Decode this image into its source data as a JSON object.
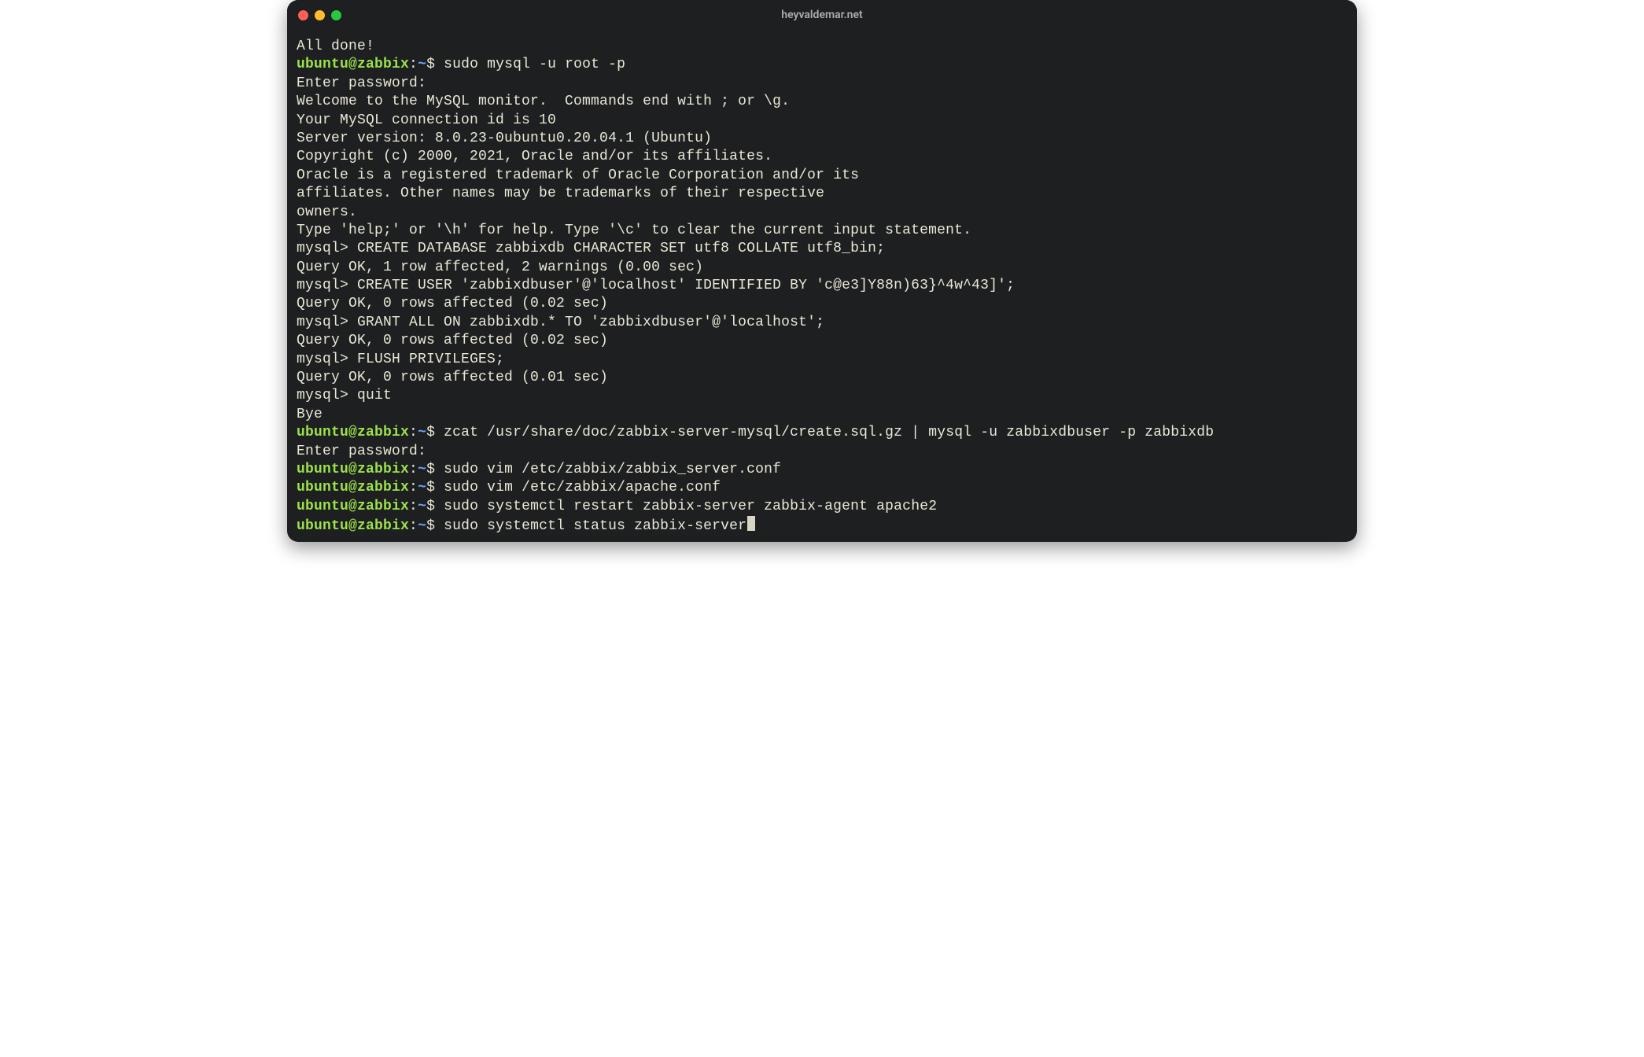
{
  "window": {
    "title": "heyvaldemar.net",
    "traffic_lights": [
      "close",
      "minimize",
      "zoom"
    ]
  },
  "prompt": {
    "user": "ubuntu",
    "at": "@",
    "host": "zabbix",
    "colon": ":",
    "path": "~",
    "dollar": "$ "
  },
  "colors": {
    "bg": "#1e1f21",
    "fg": "#e9e8d6",
    "user": "#9be24a",
    "path": "#6aa6ff"
  },
  "lines": {
    "l00": "All done!",
    "cmd01": "sudo mysql -u root -p",
    "l02": "Enter password:",
    "l03": "Welcome to the MySQL monitor.  Commands end with ; or \\g.",
    "l04": "Your MySQL connection id is 10",
    "l05": "Server version: 8.0.23-0ubuntu0.20.04.1 (Ubuntu)",
    "l06": "",
    "l07": "Copyright (c) 2000, 2021, Oracle and/or its affiliates.",
    "l08": "",
    "l09": "Oracle is a registered trademark of Oracle Corporation and/or its",
    "l10": "affiliates. Other names may be trademarks of their respective",
    "l11": "owners.",
    "l12": "",
    "l13": "Type 'help;' or '\\h' for help. Type '\\c' to clear the current input statement.",
    "l14": "",
    "l15": "mysql> CREATE DATABASE zabbixdb CHARACTER SET utf8 COLLATE utf8_bin;",
    "l16": "Query OK, 1 row affected, 2 warnings (0.00 sec)",
    "l17": "",
    "l18": "mysql> CREATE USER 'zabbixdbuser'@'localhost' IDENTIFIED BY 'c@e3]Y88n)63}^4w^43]';",
    "l19": "Query OK, 0 rows affected (0.02 sec)",
    "l20": "",
    "l21": "mysql> GRANT ALL ON zabbixdb.* TO 'zabbixdbuser'@'localhost';",
    "l22": "Query OK, 0 rows affected (0.02 sec)",
    "l23": "",
    "l24": "mysql> FLUSH PRIVILEGES;",
    "l25": "Query OK, 0 rows affected (0.01 sec)",
    "l26": "",
    "l27": "mysql> quit",
    "l28": "Bye",
    "cmd29": "zcat /usr/share/doc/zabbix-server-mysql/create.sql.gz | mysql -u zabbixdbuser -p zabbixdb",
    "l30": "Enter password:",
    "cmd31": "sudo vim /etc/zabbix/zabbix_server.conf",
    "cmd32": "sudo vim /etc/zabbix/apache.conf",
    "cmd33": "sudo systemctl restart zabbix-server zabbix-agent apache2",
    "cmd34": "sudo systemctl status zabbix-server"
  }
}
